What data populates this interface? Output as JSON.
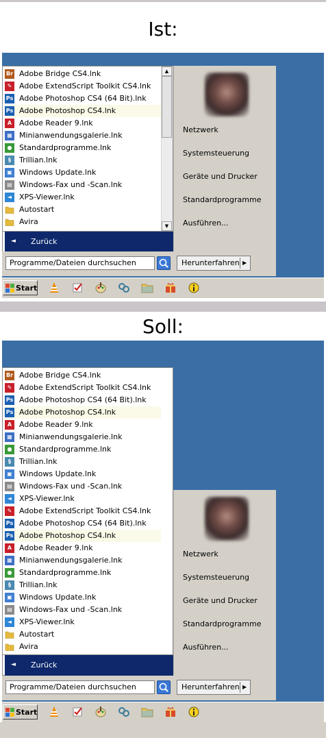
{
  "top": {
    "heading": "Ist:",
    "items": [
      {
        "icon": "adobe-bridge-icon",
        "label": "Adobe Bridge CS4.lnk",
        "color": "#b05a1e",
        "glyph": "Br"
      },
      {
        "icon": "adobe-extendscript-icon",
        "label": "Adobe ExtendScript Toolkit CS4.lnk",
        "color": "#c8202a",
        "glyph": "✎"
      },
      {
        "icon": "photoshop-icon",
        "label": "Adobe Photoshop CS4 (64 Bit).lnk",
        "color": "#1c5fb2",
        "glyph": "Ps"
      },
      {
        "icon": "photoshop-icon",
        "label": "Adobe Photoshop CS4.lnk",
        "color": "#1c5fb2",
        "glyph": "Ps",
        "highlight": true
      },
      {
        "icon": "adobe-reader-icon",
        "label": "Adobe Reader 9.lnk",
        "color": "#c8202a",
        "glyph": "A"
      },
      {
        "icon": "gallery-icon",
        "label": "Minianwendungsgalerie.lnk",
        "color": "#3d6fc4",
        "glyph": "▦"
      },
      {
        "icon": "default-programs-icon",
        "label": "Standardprogramme.lnk",
        "color": "#3a9a3a",
        "glyph": "●"
      },
      {
        "icon": "trillian-icon",
        "label": "Trillian.lnk",
        "color": "#4a8ab0",
        "glyph": "§"
      },
      {
        "icon": "windows-update-icon",
        "label": "Windows Update.lnk",
        "color": "#3f7fd0",
        "glyph": "▣"
      },
      {
        "icon": "fax-icon",
        "label": "Windows-Fax und -Scan.lnk",
        "color": "#8a8a8a",
        "glyph": "▤"
      },
      {
        "icon": "xps-viewer-icon",
        "label": "XPS-Viewer.lnk",
        "color": "#2f86d6",
        "glyph": "◄"
      },
      {
        "icon": "folder-icon",
        "label": "Autostart",
        "color": "#e5b93c",
        "glyph": ""
      },
      {
        "icon": "folder-icon",
        "label": "Avira",
        "color": "#e5b93c",
        "glyph": ""
      }
    ],
    "back_label": "Zurück",
    "right_links": [
      "Netzwerk",
      "Systemsteuerung",
      "Geräte und Drucker",
      "Standardprogramme",
      "Ausführen..."
    ],
    "search_placeholder": "Programme/Dateien durchsuchen",
    "shutdown_label": "Herunterfahren",
    "start_label": "Start"
  },
  "bottom": {
    "heading": "Soll:",
    "items": [
      {
        "icon": "adobe-bridge-icon",
        "label": "Adobe Bridge CS4.lnk",
        "color": "#b05a1e",
        "glyph": "Br"
      },
      {
        "icon": "adobe-extendscript-icon",
        "label": "Adobe ExtendScript Toolkit CS4.lnk",
        "color": "#c8202a",
        "glyph": "✎"
      },
      {
        "icon": "photoshop-icon",
        "label": "Adobe Photoshop CS4 (64 Bit).lnk",
        "color": "#1c5fb2",
        "glyph": "Ps"
      },
      {
        "icon": "photoshop-icon",
        "label": "Adobe Photoshop CS4.lnk",
        "color": "#1c5fb2",
        "glyph": "Ps",
        "highlight": true
      },
      {
        "icon": "adobe-reader-icon",
        "label": "Adobe Reader 9.lnk",
        "color": "#c8202a",
        "glyph": "A"
      },
      {
        "icon": "gallery-icon",
        "label": "Minianwendungsgalerie.lnk",
        "color": "#3d6fc4",
        "glyph": "▦"
      },
      {
        "icon": "default-programs-icon",
        "label": "Standardprogramme.lnk",
        "color": "#3a9a3a",
        "glyph": "●"
      },
      {
        "icon": "trillian-icon",
        "label": "Trillian.lnk",
        "color": "#4a8ab0",
        "glyph": "§"
      },
      {
        "icon": "windows-update-icon",
        "label": "Windows Update.lnk",
        "color": "#3f7fd0",
        "glyph": "▣"
      },
      {
        "icon": "fax-icon",
        "label": "Windows-Fax und -Scan.lnk",
        "color": "#8a8a8a",
        "glyph": "▤"
      },
      {
        "icon": "xps-viewer-icon",
        "label": "XPS-Viewer.lnk",
        "color": "#2f86d6",
        "glyph": "◄"
      },
      {
        "icon": "adobe-extendscript-icon",
        "label": "Adobe ExtendScript Toolkit CS4.lnk",
        "color": "#c8202a",
        "glyph": "✎"
      },
      {
        "icon": "photoshop-icon",
        "label": "Adobe Photoshop CS4 (64 Bit).lnk",
        "color": "#1c5fb2",
        "glyph": "Ps"
      },
      {
        "icon": "photoshop-icon",
        "label": "Adobe Photoshop CS4.lnk",
        "color": "#1c5fb2",
        "glyph": "Ps",
        "highlight": true
      },
      {
        "icon": "adobe-reader-icon",
        "label": "Adobe Reader 9.lnk",
        "color": "#c8202a",
        "glyph": "A"
      },
      {
        "icon": "gallery-icon",
        "label": "Minianwendungsgalerie.lnk",
        "color": "#3d6fc4",
        "glyph": "▦"
      },
      {
        "icon": "default-programs-icon",
        "label": "Standardprogramme.lnk",
        "color": "#3a9a3a",
        "glyph": "●"
      },
      {
        "icon": "trillian-icon",
        "label": "Trillian.lnk",
        "color": "#4a8ab0",
        "glyph": "§"
      },
      {
        "icon": "windows-update-icon",
        "label": "Windows Update.lnk",
        "color": "#3f7fd0",
        "glyph": "▣"
      },
      {
        "icon": "fax-icon",
        "label": "Windows-Fax und -Scan.lnk",
        "color": "#8a8a8a",
        "glyph": "▤"
      },
      {
        "icon": "xps-viewer-icon",
        "label": "XPS-Viewer.lnk",
        "color": "#2f86d6",
        "glyph": "◄"
      },
      {
        "icon": "folder-icon",
        "label": "Autostart",
        "color": "#e5b93c",
        "glyph": ""
      },
      {
        "icon": "folder-icon",
        "label": "Avira",
        "color": "#e5b93c",
        "glyph": ""
      }
    ],
    "back_label": "Zurück",
    "right_links": [
      "Netzwerk",
      "Systemsteuerung",
      "Geräte und Drucker",
      "Standardprogramme",
      "Ausführen..."
    ],
    "search_placeholder": "Programme/Dateien durchsuchen",
    "shutdown_label": "Herunterfahren",
    "start_label": "Start"
  },
  "quick_launch": [
    "vlc-icon",
    "checklist-icon",
    "paint-icon",
    "trillian-icon",
    "folder-icon",
    "gift-icon",
    "info-icon"
  ],
  "colors": {
    "desktop": "#3a6ea5",
    "back_bar": "#0e286b",
    "taskbar": "#d4d0c8"
  }
}
